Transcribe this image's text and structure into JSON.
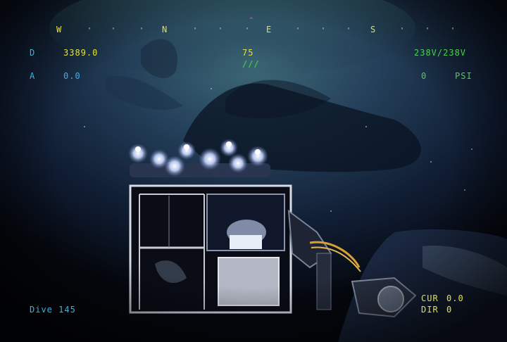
{
  "hud": {
    "compass": {
      "cardinals": [
        "W",
        "N",
        "E",
        "S"
      ],
      "tick_marks": [
        "'",
        "'",
        "'",
        "'",
        "'",
        "'",
        "'",
        "'",
        "'",
        "'",
        "'",
        "'",
        "'"
      ],
      "heading_marker": "^"
    },
    "depth_label": "D",
    "depth_value": "3389.0",
    "altitude_label": "A",
    "altitude_value": "0.0",
    "heading_value": "75",
    "heading_bar": "///",
    "voltage": "238V/238V",
    "pressure_value": "0",
    "pressure_unit": "PSI",
    "dive": "Dive 145",
    "current_label": "CUR",
    "current_value": "0.0",
    "direction_label": "DIR",
    "direction_value": "0"
  },
  "colors": {
    "hud_yellow": "#e4e23a",
    "hud_cyan": "#37b3e6",
    "hud_green": "#49d24a",
    "water_deep": "#0b1426"
  }
}
